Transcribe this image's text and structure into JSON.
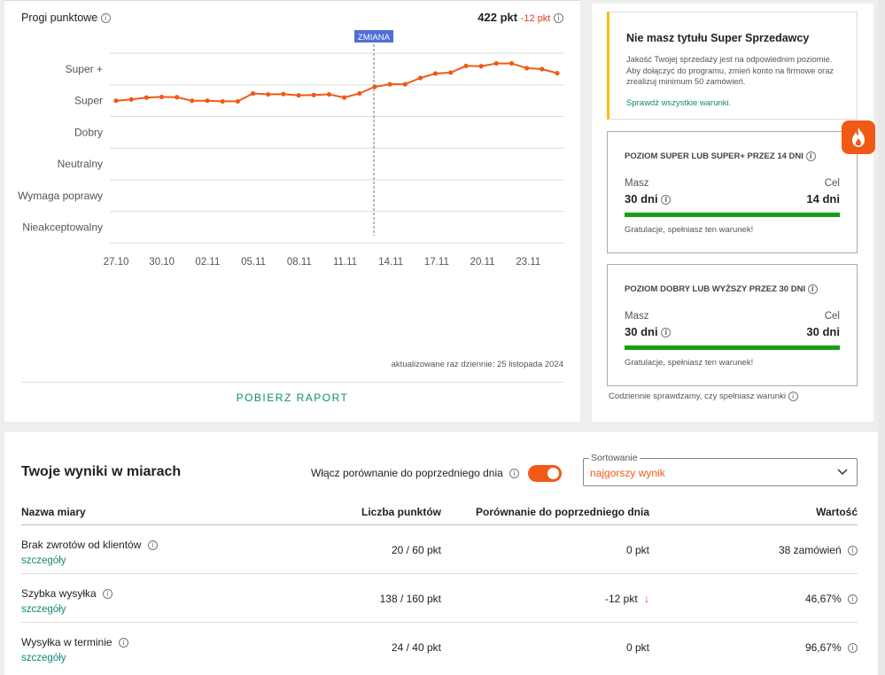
{
  "chart_section": {
    "title": "Progi punktowe",
    "score": "422 pkt",
    "delta": "-12 pkt",
    "change_marker": "ZMIANA",
    "updated": "aktualizowane raz dziennie: 25 listopada 2024",
    "report_button": "POBIERZ RAPORT"
  },
  "chart_data": {
    "type": "line",
    "title": "Progi punktowe",
    "y_levels": [
      "Super +",
      "Super",
      "Dobry",
      "Neutralny",
      "Wymaga poprawy",
      "Nieakceptowalny"
    ],
    "x_ticks": [
      "27.10",
      "30.10",
      "02.11",
      "05.11",
      "08.11",
      "11.11",
      "14.11",
      "17.11",
      "20.11",
      "23.11"
    ],
    "series": [
      {
        "values": [
          0.0,
          0.04,
          0.1,
          0.12,
          0.11,
          0.0,
          0.0,
          -0.02,
          -0.02,
          0.23,
          0.2,
          0.21,
          0.17,
          0.18,
          0.2,
          0.1,
          0.23,
          0.44,
          0.52,
          0.52,
          0.72,
          0.86,
          0.89,
          1.1,
          1.09,
          1.18,
          1.18,
          1.03,
          1.0,
          0.87
        ]
      }
    ],
    "change_index": 17,
    "color": "#f05a16",
    "grid": true
  },
  "side": {
    "alert_title": "Nie masz tytułu Super Sprzedawcy",
    "alert_text": "Jakość Twojej sprzedaży jest na odpowiednim poziomie. Aby dołączyć do programu, zmień konto na firmowe oraz zrealizuj minimum 50 zamówień.",
    "alert_link": "Sprawdź wszystkie warunki.",
    "box1": {
      "title": "POZIOM SUPER LUB SUPER+ PRZEZ 14 DNI",
      "have_label": "Masz",
      "have": "30 dni",
      "goal_label": "Cel",
      "goal": "14 dni",
      "progress": 1.0,
      "note": "Gratulacje, spełniasz ten warunek!"
    },
    "box2": {
      "title": "POZIOM DOBRY LUB WYŻSZY PRZEZ 30 DNI",
      "have_label": "Masz",
      "have": "30 dni",
      "goal_label": "Cel",
      "goal": "30 dni",
      "progress": 1.0,
      "note": "Gratulacje, spełniasz ten warunek!"
    },
    "footer": "Codziennie sprawdzamy, czy spełniasz warunki"
  },
  "results": {
    "title": "Twoje wyniki w miarach",
    "compare_label": "Włącz porównanie do poprzedniego dnia",
    "compare_on": true,
    "sort_legend": "Sortowanie",
    "sort_value": "najgorszy wynik",
    "columns": [
      "Nazwa miary",
      "Liczba punktów",
      "Porównanie do poprzedniego dnia",
      "Wartość"
    ],
    "rows": [
      {
        "name": "Brak zwrotów od klientów",
        "link": "szczegóły",
        "points": "20 / 60 pkt",
        "compare": "0 pkt",
        "value": "38 zamówień"
      },
      {
        "name": "Szybka wysyłka",
        "link": "szczegóły",
        "points": "138 / 160 pkt",
        "compare": "-12 pkt",
        "value": "46,67%"
      },
      {
        "name": "Wysyłka w terminie",
        "link": "szczegóły",
        "points": "24 / 40 pkt",
        "compare": "0 pkt",
        "value": "96,67%"
      }
    ],
    "arrow_down": "↓"
  },
  "colors": {
    "accent": "#f05a16",
    "link": "#108a72",
    "success": "#14a014",
    "warning": "#f5c000",
    "marker": "#4f6fd8"
  }
}
